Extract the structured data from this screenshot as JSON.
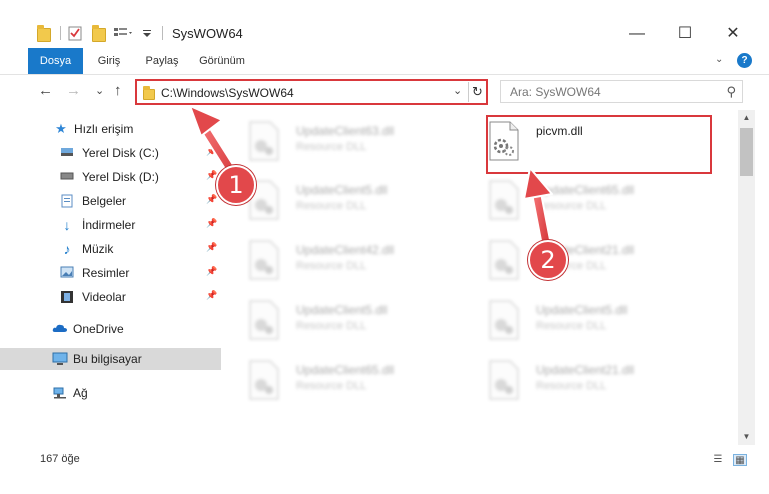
{
  "window": {
    "title": "SysWOW64",
    "minimize_glyph": "—",
    "maximize_glyph": "☐",
    "close_glyph": "✕"
  },
  "ribbon": {
    "tabs": [
      {
        "label": "Dosya"
      },
      {
        "label": "Giriş"
      },
      {
        "label": "Paylaş"
      },
      {
        "label": "Görünüm"
      }
    ],
    "expand_glyph": "⌄",
    "help_glyph": "?"
  },
  "navigation": {
    "back_glyph": "←",
    "forward_glyph": "→",
    "recent_glyph": "⌄",
    "up_glyph": "↑",
    "address": "C:\\Windows\\SysWOW64",
    "address_dropdown_glyph": "⌄",
    "refresh_glyph": "↻",
    "search_placeholder": "Ara: SysWOW64",
    "search_glyph": "⚲"
  },
  "sidebar": {
    "items": [
      {
        "label": "Hızlı erişim",
        "icon": "star-icon"
      },
      {
        "label": "Yerel Disk (C:)",
        "icon": "drive-icon"
      },
      {
        "label": "Yerel Disk (D:)",
        "icon": "drive-icon"
      },
      {
        "label": "Belgeler",
        "icon": "documents-icon"
      },
      {
        "label": "İndirmeler",
        "icon": "download-icon"
      },
      {
        "label": "Müzik",
        "icon": "music-icon"
      },
      {
        "label": "Resimler",
        "icon": "pictures-icon"
      },
      {
        "label": "Videolar",
        "icon": "videos-icon"
      },
      {
        "label": "OneDrive",
        "icon": "cloud-icon"
      },
      {
        "label": "Bu bilgisayar",
        "icon": "computer-icon"
      },
      {
        "label": "Ağ",
        "icon": "network-icon"
      }
    ],
    "pin_glyph": "📌"
  },
  "files": [
    {
      "name": "UpdateClient63.dll",
      "type": "Resource DLL"
    },
    {
      "name": "picvm.dll",
      "type": ""
    },
    {
      "name": "UpdateClient5.dll",
      "type": "Resource DLL"
    },
    {
      "name": "UpdateClient65.dll",
      "type": "Resource DLL"
    },
    {
      "name": "UpdateClient42.dll",
      "type": "Resource DLL"
    },
    {
      "name": "UpdateClient21.dll",
      "type": "Resource DLL"
    },
    {
      "name": "UpdateClient5.dll",
      "type": "Resource DLL"
    },
    {
      "name": "UpdateClient5.dll",
      "type": "Resource DLL"
    },
    {
      "name": "UpdateClient65.dll",
      "type": "Resource DLL"
    },
    {
      "name": "UpdateClient21.dll",
      "type": "Resource DLL"
    }
  ],
  "status": {
    "item_count": "167 öğe"
  },
  "annotations": {
    "badge1": "1",
    "badge2": "2",
    "color": "#e2484b"
  },
  "colors": {
    "accent": "#1979ca",
    "highlight": "#d9383c"
  }
}
